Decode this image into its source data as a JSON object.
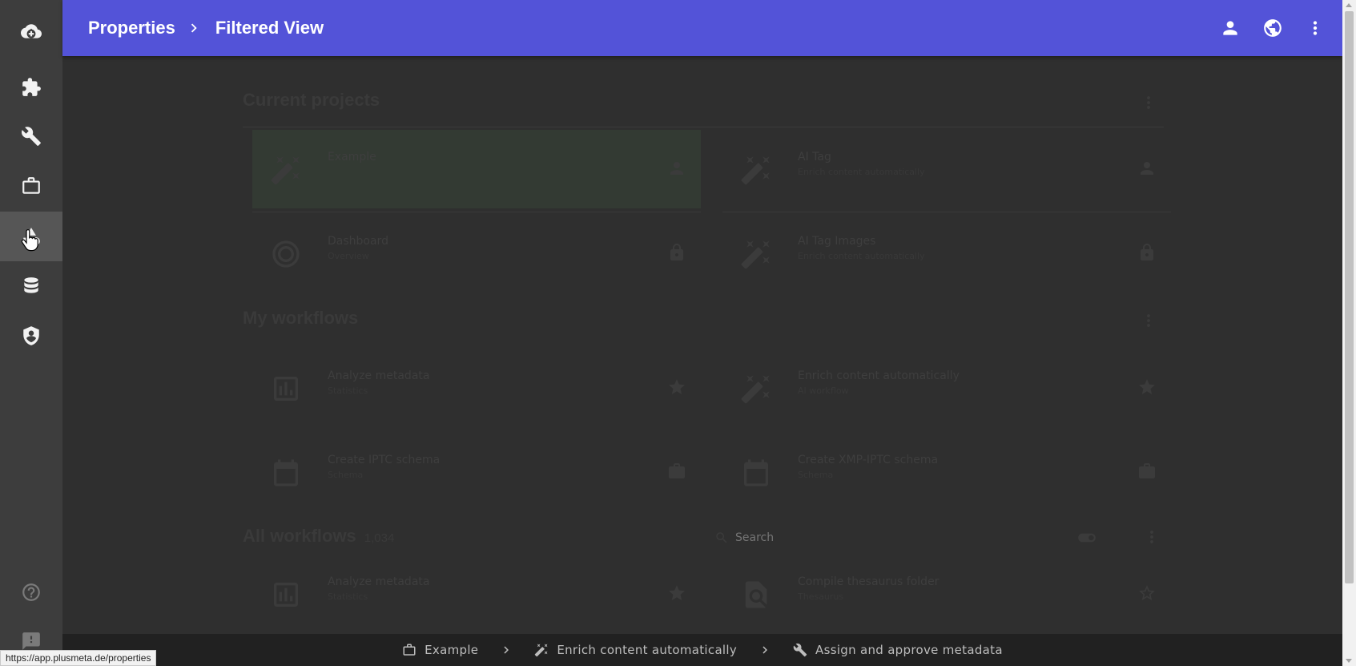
{
  "header": {
    "breadcrumb_root": "Properties",
    "breadcrumb_current": "Filtered View",
    "bg_color": "#5353d8",
    "icons": [
      "person-icon",
      "globe-icon",
      "more-vert-icon"
    ]
  },
  "sidebar": {
    "items": [
      {
        "name": "cloud-upload-icon",
        "active": false
      },
      {
        "name": "puzzle-icon",
        "active": false
      },
      {
        "name": "wrench-icon",
        "active": false
      },
      {
        "name": "briefcase-icon",
        "active": false
      },
      {
        "name": "shapes-icon",
        "active": true
      },
      {
        "name": "database-icon",
        "active": false
      },
      {
        "name": "shield-icon",
        "active": false
      },
      {
        "name": "help-icon",
        "active": false
      },
      {
        "name": "feedback-icon",
        "active": false
      }
    ]
  },
  "background": {
    "current_projects_title": "Current projects",
    "my_workflows_title": "My workflows",
    "all_workflows_title": "All workflows",
    "all_workflows_count": "1,034",
    "search_placeholder": "Search",
    "projects": [
      {
        "title": "Example",
        "subtitle": "",
        "highlight": true
      },
      {
        "title": "AI Tag",
        "subtitle": "Enrich content automatically",
        "highlight": false
      },
      {
        "title": "Dashboard",
        "subtitle": "Overview",
        "highlight": false
      },
      {
        "title": "AI Tag Images",
        "subtitle": "Enrich content automatically",
        "highlight": false
      }
    ],
    "my_workflows": [
      {
        "title": "Analyze metadata",
        "subtitle": "Statistics"
      },
      {
        "title": "Enrich content automatically",
        "subtitle": "AI workflow"
      },
      {
        "title": "Create IPTC schema",
        "subtitle": "Schema"
      },
      {
        "title": "Create XMP-IPTC schema",
        "subtitle": "Schema"
      }
    ],
    "all_workflows": [
      {
        "title": "Analyze metadata",
        "subtitle": "Statistics"
      },
      {
        "title": "Compile thesaurus folder",
        "subtitle": "Thesaurus"
      }
    ]
  },
  "bottom_bar": {
    "steps": [
      {
        "icon": "briefcase-outline-icon",
        "label": "Example"
      },
      {
        "icon": "magic-wand-icon",
        "label": "Enrich content automatically"
      },
      {
        "icon": "wrench-icon",
        "label": "Assign and approve metadata"
      }
    ]
  },
  "status": {
    "url": "https://app.plusmeta.de/properties"
  }
}
